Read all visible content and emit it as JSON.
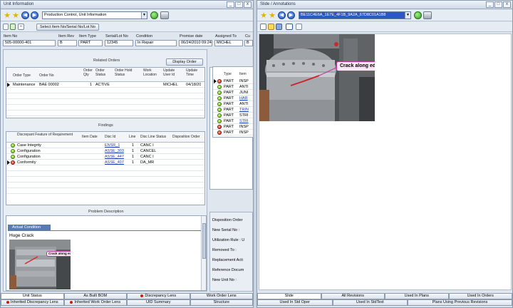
{
  "left": {
    "title": "Unit Information",
    "window_buttons": [
      "_",
      "□",
      "x"
    ],
    "view_combo": "Production Control, Unit Information",
    "select_button": "Select Item No/Serial No/Lot No",
    "header_fields": [
      {
        "label": "Item No",
        "value": "505-00000-401"
      },
      {
        "label": "Item Rev",
        "value": "B"
      },
      {
        "label": "Item Type",
        "value": "PART"
      },
      {
        "label": "Serial/Lot No",
        "value": "12345"
      },
      {
        "label": "Condition",
        "value": "In Repair"
      },
      {
        "label": "Promise date",
        "value": "06/24/2010 09:24"
      },
      {
        "label": "Assigned To",
        "value": "MICHEL"
      },
      {
        "label": "Cu",
        "value": "B"
      }
    ],
    "related_orders": {
      "title": "Related Orders",
      "display_button": "Display Order",
      "columns": [
        "Order Type",
        "Order No",
        "Order Qty",
        "Order Status",
        "Order Hold Status",
        "Work Location",
        "Update User Id",
        "Update Time"
      ],
      "rows": [
        {
          "type": "Maintenance",
          "no": "BAE 00002",
          "qty": "1",
          "status": "ACTIVE",
          "hold": "",
          "loc": "",
          "user": "MICHEL",
          "time": "04/18/20"
        }
      ]
    },
    "findings": {
      "title": "Findings",
      "columns": [
        "Discrepant Feature of Requirement",
        "Item Date",
        "Disc Id",
        "Line",
        "Disc Line Status",
        "Disposition Order"
      ],
      "rows": [
        {
          "status": "green",
          "feature": "Case Integrity",
          "disc_id": "ENSR_1",
          "line": "1",
          "line_status": "CANC I"
        },
        {
          "status": "green",
          "feature": "Configuration",
          "disc_id": "ASSE_303",
          "line": "1",
          "line_status": "CANCEL"
        },
        {
          "status": "green",
          "feature": "Configuration",
          "disc_id": "ASSE_447",
          "line": "1",
          "line_status": "CANC I"
        },
        {
          "status": "red",
          "feature": "Conformity",
          "disc_id": "ASSE_407",
          "line": "1",
          "line_status": "DA_MR"
        }
      ]
    },
    "problem": {
      "title": "Problem Description",
      "tab": "Actual Condition",
      "heading": "Huge Crack",
      "callout": "Crack along edge"
    },
    "disposition_labels": [
      "Disposition Order",
      "New Serial No :",
      "Utilization Rule : U",
      "Removed To :",
      "Replacement Acti",
      "Reference Docum",
      "New Unit No :"
    ],
    "tabs_row1": [
      {
        "label": "Unit Status",
        "dot": false
      },
      {
        "label": "As Built BOM",
        "dot": false
      },
      {
        "label": "Discrepancy Lens",
        "dot": true
      },
      {
        "label": "Work Order Lens",
        "dot": false
      }
    ],
    "tabs_row2": [
      {
        "label": "Inherited Discrepancy Lens",
        "dot": true
      },
      {
        "label": "Inherited Work Order Lens",
        "dot": true
      },
      {
        "label": "UID Summary",
        "dot": false
      },
      {
        "label": "Structure",
        "dot": false
      }
    ]
  },
  "right": {
    "title": "Slide / Annotations",
    "window_buttons": [
      "_",
      "□",
      "x"
    ],
    "combo": "BE11C4E6A_1E7E_4F1B_9A2A_67D8C01A1B8",
    "callout": "Crack along edge",
    "status_list": {
      "columns": [
        "Type",
        "Item"
      ],
      "rows": [
        {
          "status": "red",
          "type": "PART",
          "item": "INSP"
        },
        {
          "status": "green",
          "type": "PART",
          "item": "ANTI"
        },
        {
          "status": "green",
          "type": "PART",
          "item": "JUNI"
        },
        {
          "status": "green",
          "type": "PART",
          "item": "HAR"
        },
        {
          "status": "green",
          "type": "PART",
          "item": "ANTI"
        },
        {
          "status": "green",
          "type": "PART",
          "item": "TRIN"
        },
        {
          "status": "green",
          "type": "PART",
          "item": "STRI"
        },
        {
          "status": "green",
          "type": "PART",
          "item": "STRI"
        },
        {
          "status": "red",
          "type": "PART",
          "item": "INSP"
        },
        {
          "status": "red",
          "type": "PART",
          "item": "INSP"
        }
      ]
    },
    "tabs_row1": [
      "Slide",
      "All Revisions",
      "Used In Plans",
      "Used In Orders"
    ],
    "tabs_row2": [
      "Used In Std Oper",
      "Used In StdText",
      "Plans Using Previous Revisions"
    ]
  }
}
